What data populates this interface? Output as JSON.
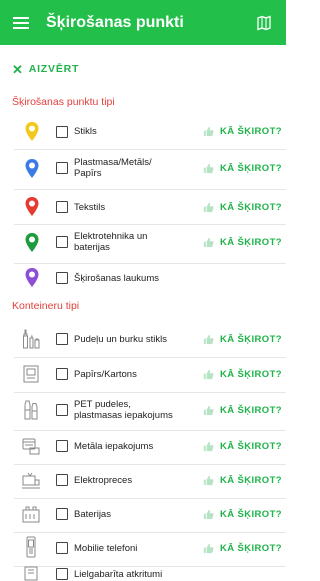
{
  "appbar": {
    "title": "Šķirošanas punkti"
  },
  "close_label": "AIZVĒRT",
  "sections": {
    "points_title": "Šķirošanas punktu tipi",
    "containers_title": "Konteineru tipi"
  },
  "how_label": "KĀ ŠĶIROT?",
  "points": [
    {
      "label": "Stikls",
      "color": "#f2c81a"
    },
    {
      "label": "Plastmasa/Metāls/ Papīrs",
      "color": "#3c7be6"
    },
    {
      "label": "Tekstils",
      "color": "#e63a32"
    },
    {
      "label": "Elektrotehnika un baterijas",
      "color": "#1e9b3c"
    },
    {
      "label": "Šķirošanas laukums",
      "color": "#8a4fd6"
    }
  ],
  "containers": [
    {
      "label": "Pudeļu un burku stikls",
      "icon": "bottles-icon"
    },
    {
      "label": "Papīrs/Kartons",
      "icon": "paper-box-icon"
    },
    {
      "label": "PET pudeles, plastmasas iepakojums",
      "icon": "pet-bottles-icon"
    },
    {
      "label": "Metāla iepakojums",
      "icon": "metal-can-icon"
    },
    {
      "label": "Elektropreces",
      "icon": "electronics-icon"
    },
    {
      "label": "Baterijas",
      "icon": "batteries-icon"
    },
    {
      "label": "Mobilie telefoni",
      "icon": "mobile-phone-icon"
    },
    {
      "label": "Lielgabarīta atkritumi",
      "icon": "bulky-waste-icon"
    }
  ]
}
